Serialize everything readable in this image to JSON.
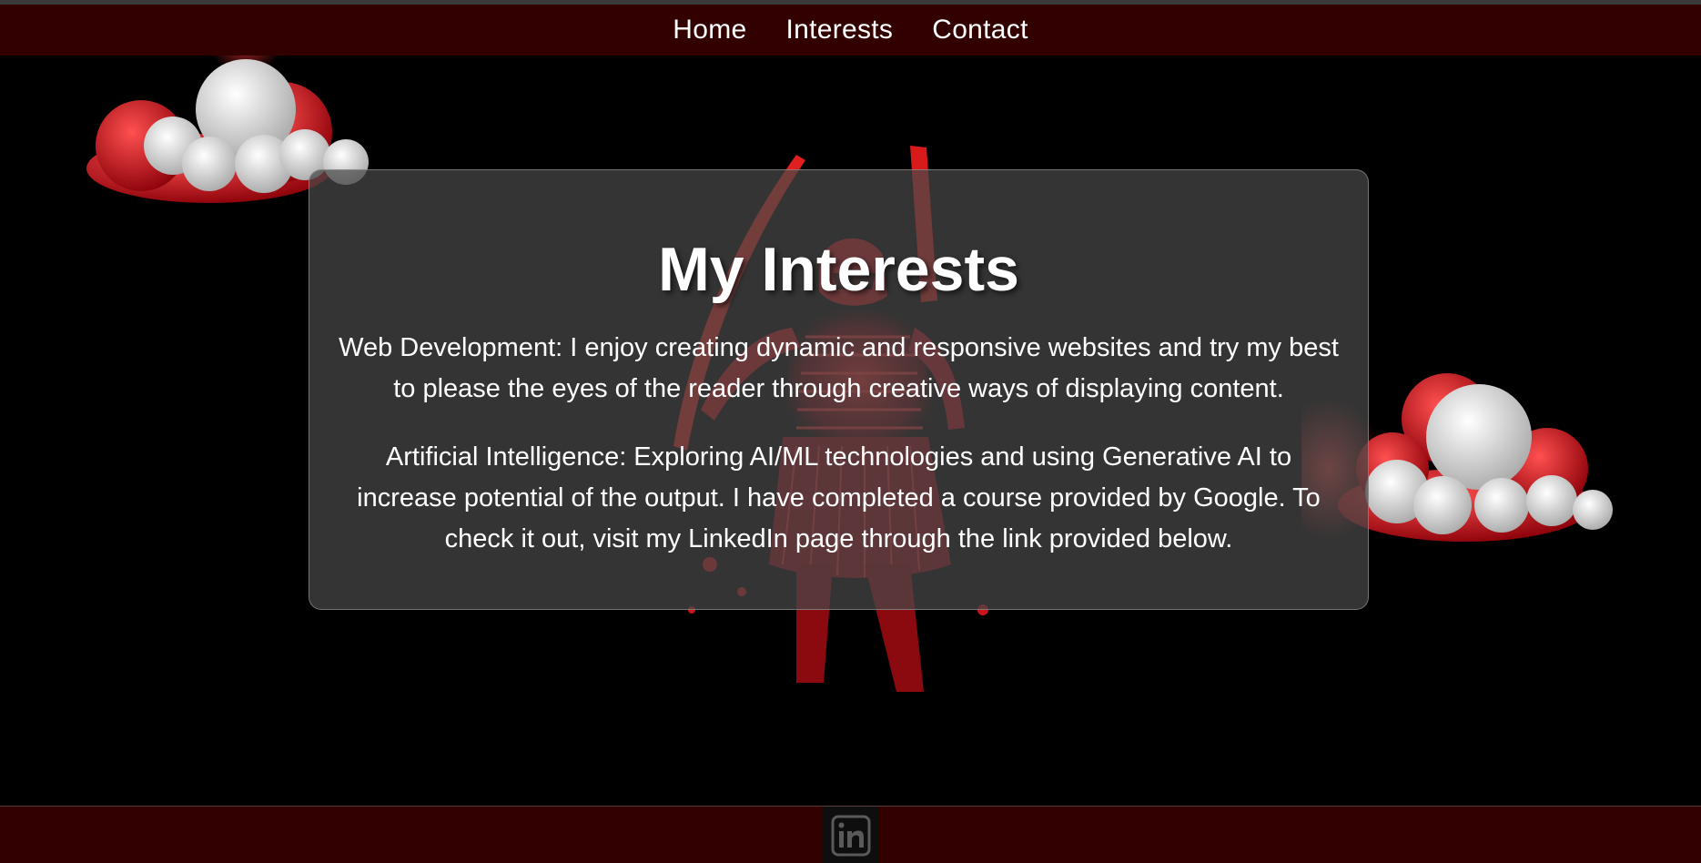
{
  "nav": {
    "links": [
      {
        "label": "Home"
      },
      {
        "label": "Interests"
      },
      {
        "label": "Contact"
      }
    ]
  },
  "main": {
    "title": "My Interests",
    "paragraphs": [
      "Web Development: I enjoy creating dynamic and responsive websites and try my best to please the eyes of the reader through creative ways of displaying content.",
      "Artificial Intelligence: Exploring AI/ML technologies and using Generative AI to increase potential of the output. I have completed a course provided by Google. To check it out, visit my LinkedIn page through the link provided below."
    ]
  },
  "footer": {
    "icon": "linkedin-icon"
  },
  "colors": {
    "nav_bg": "#330000",
    "footer_bg": "#330000",
    "accent_red": "#e0201e",
    "page_bg": "#000000"
  }
}
